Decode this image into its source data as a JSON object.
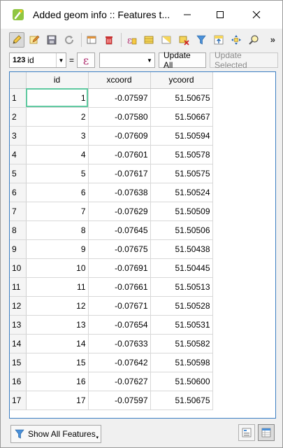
{
  "window": {
    "title": "Added geom info :: Features t...",
    "controls": {
      "minimize": "—",
      "maximize": "☐",
      "close": "✕"
    }
  },
  "toolbar": {
    "icons": [
      "pencil-icon",
      "edit-multi-icon",
      "save-icon",
      "refresh-icon",
      "new-field-icon",
      "delete-field-icon",
      "calculator-icon",
      "select-all-icon",
      "select-expression-icon",
      "deselect-icon",
      "filter-icon",
      "move-top-icon",
      "pan-icon",
      "zoom-icon"
    ],
    "overflow": "»"
  },
  "calc": {
    "field_type": "123",
    "field_name": "id",
    "equals": "=",
    "expression_symbol": "ε",
    "expression_value": "",
    "update_all": "Update All",
    "update_selected": "Update Selected"
  },
  "table": {
    "columns": [
      "id",
      "xcoord",
      "ycoord"
    ],
    "rows": [
      {
        "row": "1",
        "id": "1",
        "xcoord": "-0.07597",
        "ycoord": "51.50675"
      },
      {
        "row": "2",
        "id": "2",
        "xcoord": "-0.07580",
        "ycoord": "51.50667"
      },
      {
        "row": "3",
        "id": "3",
        "xcoord": "-0.07609",
        "ycoord": "51.50594"
      },
      {
        "row": "4",
        "id": "4",
        "xcoord": "-0.07601",
        "ycoord": "51.50578"
      },
      {
        "row": "5",
        "id": "5",
        "xcoord": "-0.07617",
        "ycoord": "51.50575"
      },
      {
        "row": "6",
        "id": "6",
        "xcoord": "-0.07638",
        "ycoord": "51.50524"
      },
      {
        "row": "7",
        "id": "7",
        "xcoord": "-0.07629",
        "ycoord": "51.50509"
      },
      {
        "row": "8",
        "id": "8",
        "xcoord": "-0.07645",
        "ycoord": "51.50506"
      },
      {
        "row": "9",
        "id": "9",
        "xcoord": "-0.07675",
        "ycoord": "51.50438"
      },
      {
        "row": "10",
        "id": "10",
        "xcoord": "-0.07691",
        "ycoord": "51.50445"
      },
      {
        "row": "11",
        "id": "11",
        "xcoord": "-0.07661",
        "ycoord": "51.50513"
      },
      {
        "row": "12",
        "id": "12",
        "xcoord": "-0.07671",
        "ycoord": "51.50528"
      },
      {
        "row": "13",
        "id": "13",
        "xcoord": "-0.07654",
        "ycoord": "51.50531"
      },
      {
        "row": "14",
        "id": "14",
        "xcoord": "-0.07633",
        "ycoord": "51.50582"
      },
      {
        "row": "15",
        "id": "15",
        "xcoord": "-0.07642",
        "ycoord": "51.50598"
      },
      {
        "row": "16",
        "id": "16",
        "xcoord": "-0.07627",
        "ycoord": "51.50600"
      },
      {
        "row": "17",
        "id": "17",
        "xcoord": "-0.07597",
        "ycoord": "51.50675"
      }
    ]
  },
  "bottom": {
    "filter_label": "Show All Features",
    "caret": "▾"
  },
  "colors": {
    "selection_outline": "#5fc9a0",
    "table_border": "#3b7ec2"
  }
}
